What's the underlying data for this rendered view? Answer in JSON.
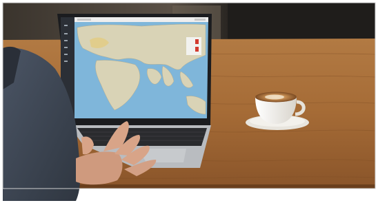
{
  "scene": {
    "description_free": true
  },
  "screen": {
    "app": "map-dashboard",
    "sidebar_icon_count": 6,
    "markers": 2
  },
  "colors": {
    "wall_dark": "#2a2622",
    "table_wood": "#a06a38",
    "table_light": "#c58d54",
    "laptop_frame": "#1b1c1f",
    "ocean": "#7fb6da",
    "land": "#d9d3b6",
    "sidebar": "#2b2f36",
    "marker_red": "#d23b2f",
    "cup_white": "#f3f1ec",
    "coffee": "#a86d38",
    "shirt": "#3e4654",
    "skin": "#d8a488"
  }
}
